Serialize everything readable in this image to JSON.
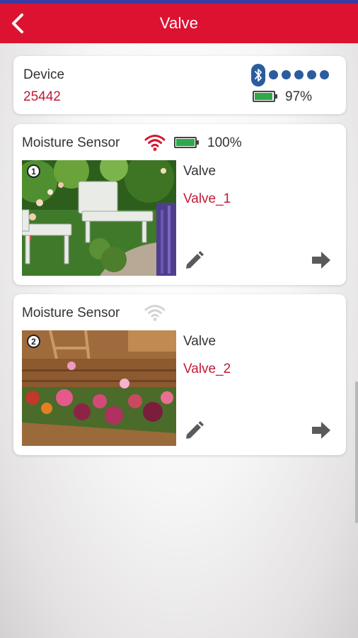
{
  "app_bar": {
    "title": "Valve",
    "back_icon": "chevron-left-icon",
    "color": "#dd1231"
  },
  "device": {
    "label": "Device",
    "id": "25442",
    "bluetooth_icon": "bluetooth-icon",
    "signal_dots": 5,
    "battery_level": 0.97,
    "battery_text": "97%"
  },
  "sensors": [
    {
      "index": "1",
      "title": "Moisture Sensor",
      "wifi_status": "connected",
      "battery_level": 1.0,
      "battery_text": "100%",
      "valve_label": "Valve",
      "valve_name": "Valve_1",
      "photo": "garden-bench-photo"
    },
    {
      "index": "2",
      "title": "Moisture Sensor",
      "wifi_status": "disconnected",
      "valve_label": "Valve",
      "valve_name": "Valve_2",
      "photo": "flower-bed-photo"
    }
  ],
  "colors": {
    "accent": "#dd1231",
    "brand_red_text": "#c21a36",
    "bluetooth": "#2b5c9e",
    "battery": "#2ea84a"
  }
}
